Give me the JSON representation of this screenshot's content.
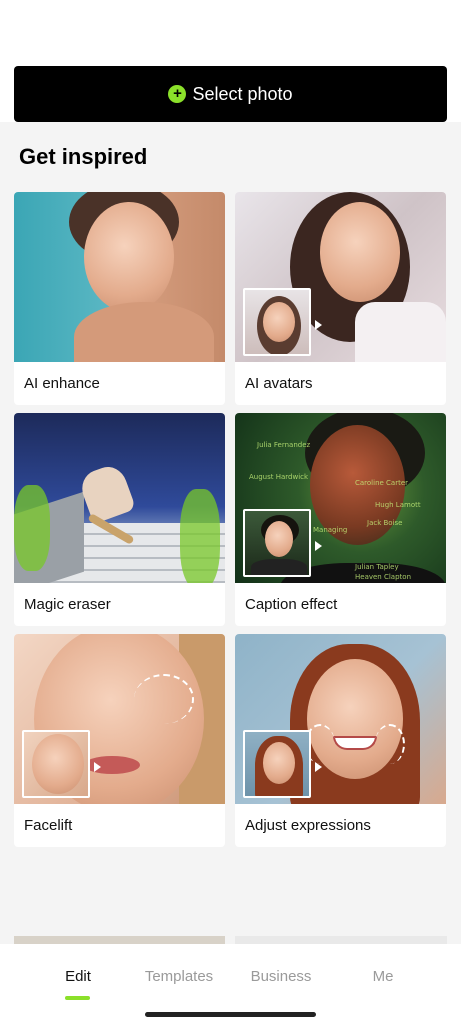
{
  "select_photo": {
    "label": "Select photo",
    "icon": "plus-circle-icon",
    "accent": "#8be02a"
  },
  "inspire": {
    "title": "Get inspired",
    "cards": [
      {
        "label": "AI enhance"
      },
      {
        "label": "AI avatars"
      },
      {
        "label": "Magic eraser"
      },
      {
        "label": "Caption effect"
      },
      {
        "label": "Facelift"
      },
      {
        "label": "Adjust expressions"
      }
    ]
  },
  "caption_overlay_lines": [
    "Julia Fernandez",
    "August Hardwick",
    "Caroline Carter",
    "Managing",
    "Hugh Lamott",
    "Jack Boise",
    "Julian Tapley",
    "Heaven Clapton"
  ],
  "nav": {
    "items": [
      {
        "label": "Edit",
        "active": true
      },
      {
        "label": "Templates",
        "active": false
      },
      {
        "label": "Business",
        "active": false
      },
      {
        "label": "Me",
        "active": false
      }
    ],
    "accent": "#8be02a"
  }
}
